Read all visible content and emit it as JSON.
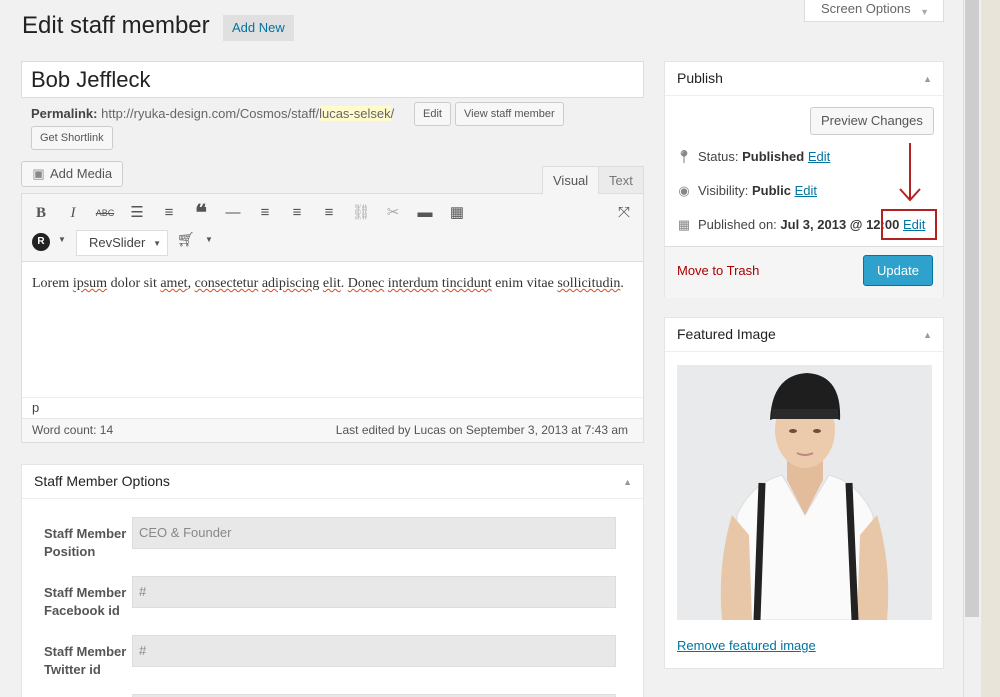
{
  "header": {
    "title": "Edit staff member",
    "add_new": "Add New",
    "screen_options": "Screen Options"
  },
  "post": {
    "title": "Bob Jeffleck",
    "permalink_label": "Permalink:",
    "permalink_base": "http://ryuka-design.com/Cosmos/staff/",
    "permalink_slug": "lucas-selsek",
    "permalink_end": "/",
    "edit_btn": "Edit",
    "view_btn": "View staff member",
    "shortlink_btn": "Get Shortlink"
  },
  "editor": {
    "add_media": "Add Media",
    "tab_visual": "Visual",
    "tab_text": "Text",
    "revslider": "RevSlider",
    "content_parts": [
      "Lorem ",
      "ipsum",
      " dolor sit ",
      "amet",
      ", ",
      "consectetur",
      " ",
      "adipiscing",
      " ",
      "elit",
      ". ",
      "Donec",
      " ",
      "interdum",
      " ",
      "tincidunt",
      " ",
      "enim",
      " ",
      "vitae",
      " ",
      "sollicitudin",
      "."
    ],
    "path": "p",
    "word_count": "Word count: 14",
    "last_edited": "Last edited by Lucas on September 3, 2013 at 7:43 am"
  },
  "staff_options": {
    "title": "Staff Member Options",
    "fields": [
      {
        "label": "Staff Member Position",
        "value": "CEO & Founder"
      },
      {
        "label": "Staff Member Facebook id",
        "value": "#"
      },
      {
        "label": "Staff Member Twitter id",
        "value": "#"
      }
    ]
  },
  "publish": {
    "title": "Publish",
    "preview": "Preview Changes",
    "status_label": "Status:",
    "status_value": "Published",
    "visibility_label": "Visibility:",
    "visibility_value": "Public",
    "published_label": "Published on:",
    "published_value": "Jul 3, 2013 @ 12:00",
    "edit": "Edit",
    "trash": "Move to Trash",
    "update": "Update"
  },
  "featured": {
    "title": "Featured Image",
    "remove": "Remove featured image"
  },
  "colors": {
    "accent": "#0074a2",
    "update_button": "#2ea2cc",
    "trash": "#aa0000",
    "annotation": "#b22222"
  }
}
